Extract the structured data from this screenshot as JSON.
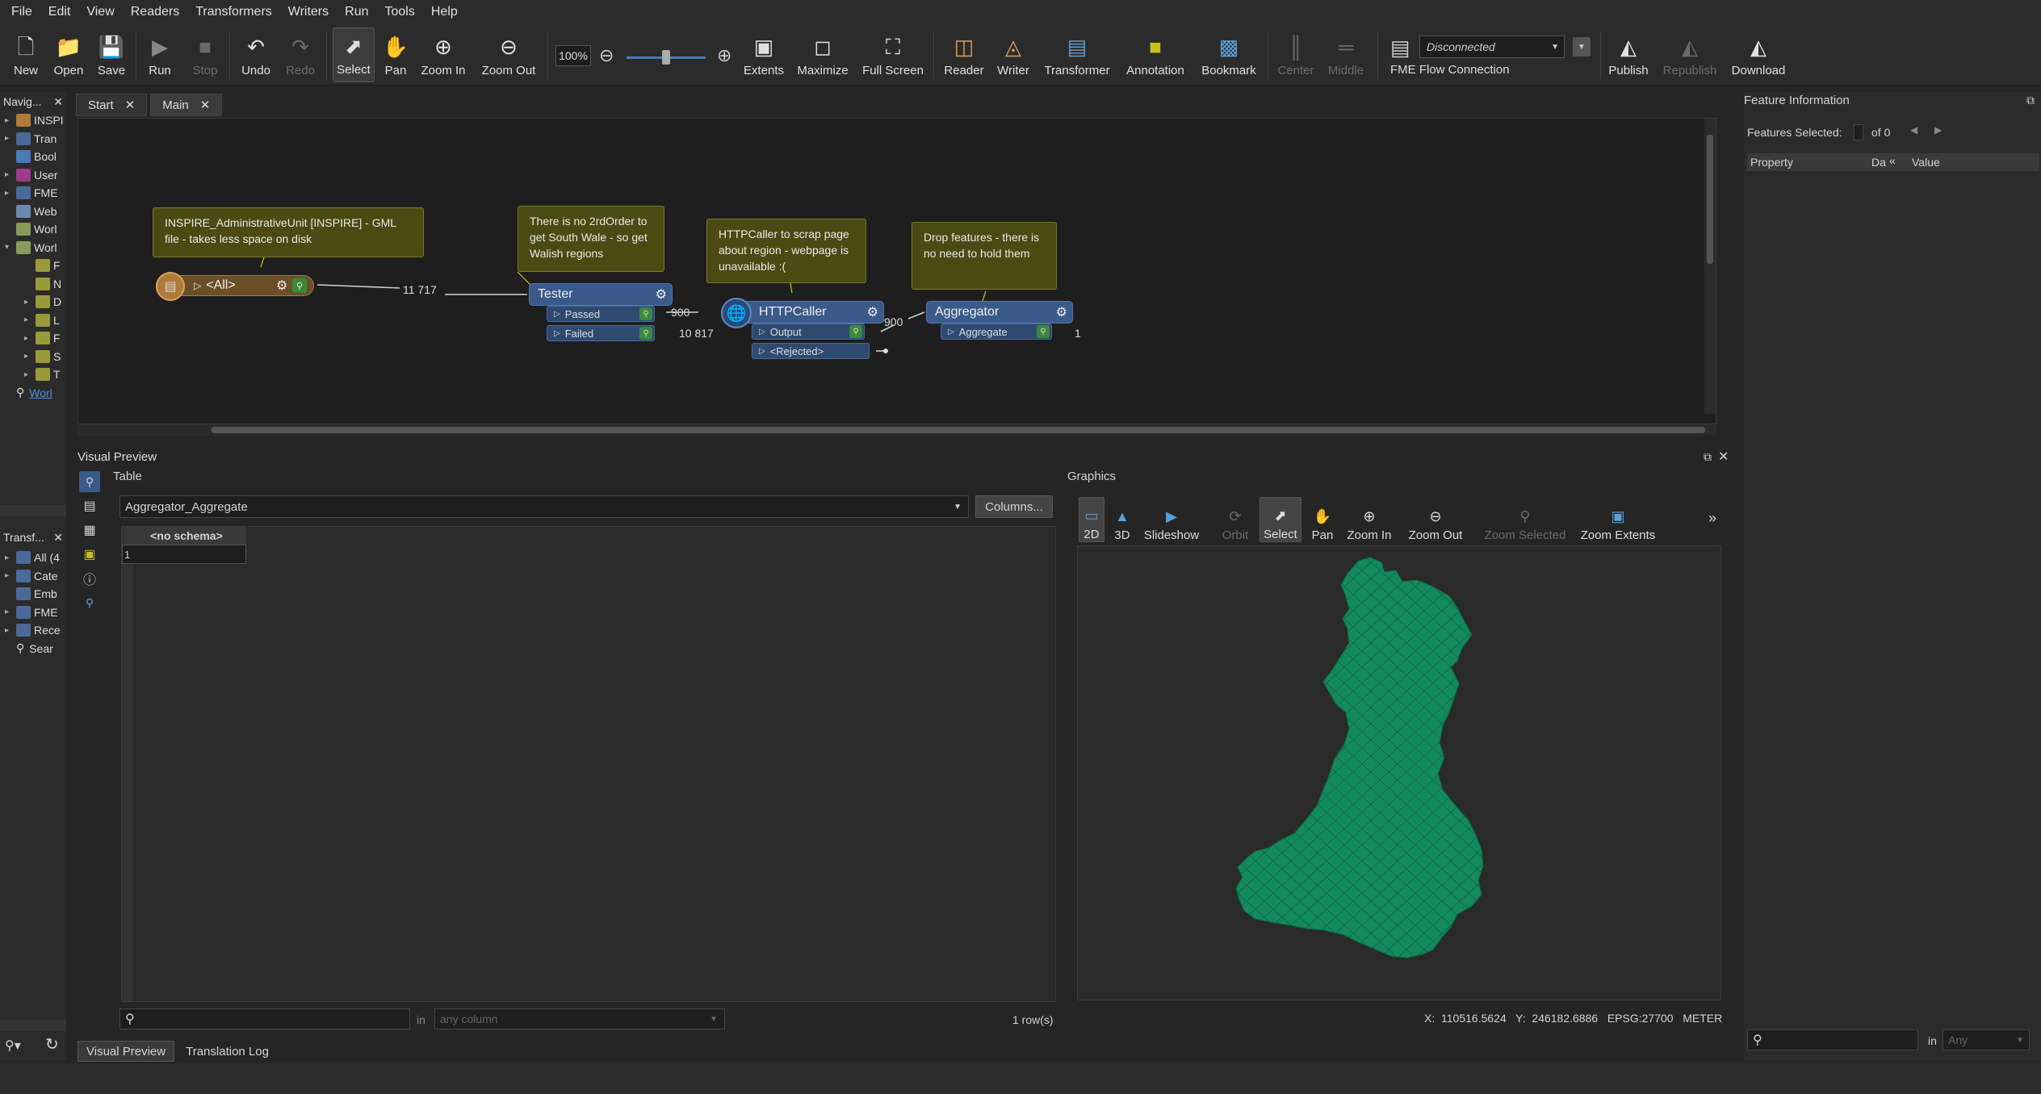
{
  "menu": [
    "File",
    "Edit",
    "View",
    "Readers",
    "Transformers",
    "Writers",
    "Run",
    "Tools",
    "Help"
  ],
  "toolbar": {
    "new": "New",
    "open": "Open",
    "save": "Save",
    "run": "Run",
    "stop": "Stop",
    "undo": "Undo",
    "redo": "Redo",
    "select": "Select",
    "pan": "Pan",
    "zoom_in": "Zoom In",
    "zoom_out": "Zoom Out",
    "zoom_level": "100%",
    "extents": "Extents",
    "maximize": "Maximize",
    "full_screen": "Full Screen",
    "reader": "Reader",
    "writer": "Writer",
    "transformer": "Transformer",
    "annotation": "Annotation",
    "bookmark": "Bookmark",
    "center": "Center",
    "middle": "Middle",
    "connection_status": "Disconnected",
    "fme_flow": "FME Flow Connection",
    "publish": "Publish",
    "republish": "Republish",
    "download": "Download"
  },
  "navigator": {
    "title": "Navig...",
    "items": [
      "INSPI",
      "Tran",
      "Bool",
      "User",
      "FME",
      "Web",
      "Worl",
      "Worl",
      "F",
      "N",
      "D",
      "L",
      "F",
      "S",
      "T",
      "Worl"
    ]
  },
  "transformer_gallery": {
    "title": "Transf...",
    "items": [
      "All (4",
      "Cate",
      "Emb",
      "FME",
      "Rece",
      "Sear"
    ]
  },
  "tabs": [
    "Start",
    "Main"
  ],
  "canvas": {
    "annotations": [
      "INSPIRE_AdministrativeUnit [INSPIRE] - GML file - takes less space on disk",
      "There is no 2rdOrder to get South Wale - so get Walish regions",
      "HTTPCaller to scrap page about region - webpage is unavailable :(",
      "Drop features - there is no need to hold them"
    ],
    "reader_label": "<All>",
    "tester": "Tester",
    "passed": "Passed",
    "failed": "Failed",
    "httpcaller": "HTTPCaller",
    "output": "Output",
    "rejected": "<Rejected>",
    "aggregator": "Aggregator",
    "aggregate": "Aggregate",
    "counts": {
      "reader": "11 717",
      "passed": "900",
      "failed": "10 817",
      "output": "900",
      "aggregate": "1"
    }
  },
  "visual_preview": {
    "title": "Visual Preview",
    "table_label": "Table",
    "dataset": "Aggregator_Aggregate",
    "columns_btn": "Columns...",
    "schema_header": "<no schema>",
    "row_num": "1",
    "search_in": "in",
    "column_placeholder": "any column",
    "row_count": "1 row(s)"
  },
  "graphics": {
    "title": "Graphics",
    "buttons": [
      "2D",
      "3D",
      "Slideshow",
      "Orbit",
      "Select",
      "Pan",
      "Zoom In",
      "Zoom Out",
      "Zoom Selected",
      "Zoom Extents"
    ],
    "coords": {
      "x_label": "X:",
      "x": "110516.5624",
      "y_label": "Y:",
      "y": "246182.6886",
      "epsg": "EPSG:27700",
      "unit": "METER"
    },
    "map_color": "#138a5e"
  },
  "feature_info": {
    "title": "Feature Information",
    "selected_label": "Features Selected:",
    "of": "of 0",
    "col_property": "Property",
    "col_da": "Da",
    "col_value": "Value",
    "search_in": "in",
    "any": "Any"
  },
  "bottom_tabs": [
    "Visual Preview",
    "Translation Log"
  ]
}
